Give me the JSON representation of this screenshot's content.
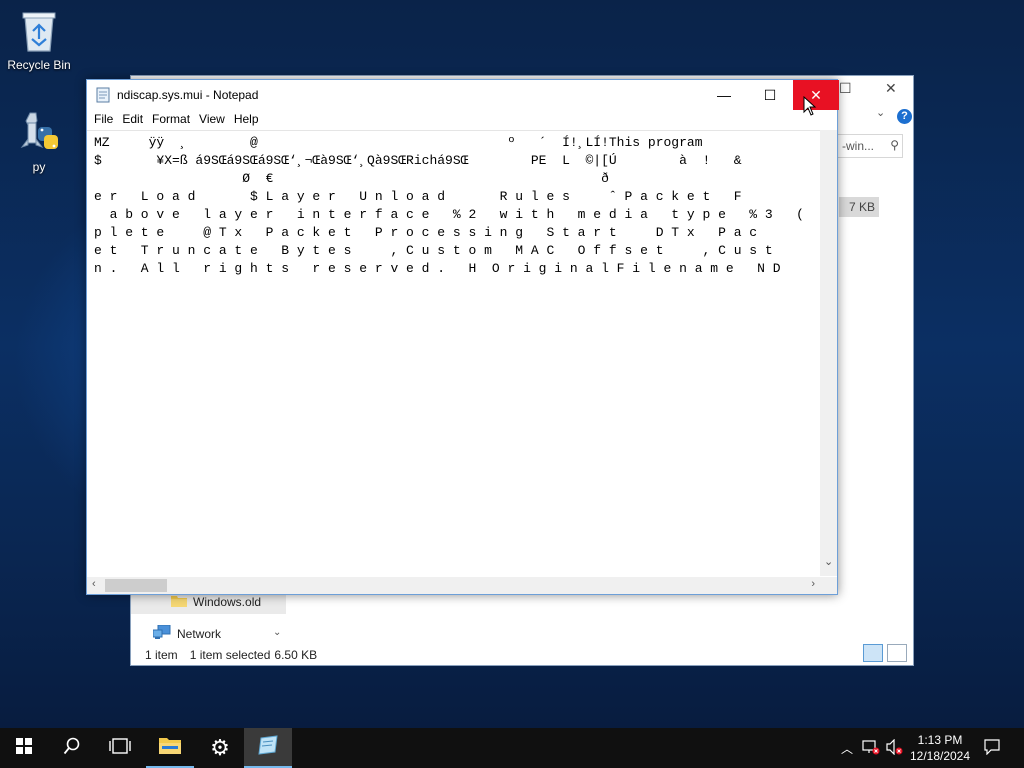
{
  "desktop": {
    "icons": [
      {
        "label": "Recycle Bin",
        "icon": "recycle-bin-icon"
      },
      {
        "label": "py",
        "icon": "python-icon"
      }
    ]
  },
  "explorer": {
    "search_placeholder": "-win...",
    "file_size": "7 KB",
    "nav_items": [
      {
        "label": "Windows.old",
        "icon": "folder-icon"
      },
      {
        "label": "Network",
        "icon": "network-icon"
      }
    ],
    "status": {
      "item_count": "1 item",
      "selected": "1 item selected",
      "size": "6.50 KB"
    }
  },
  "notepad": {
    "title": "ndiscap.sys.mui - Notepad",
    "menu": [
      "File",
      "Edit",
      "Format",
      "View",
      "Help"
    ],
    "lines": [
      "MZ     ÿÿ  ¸        @                                º   ´  Í!¸LÍ!This program",
      "$       ¥X=ß á9SŒá9SŒá9SŒ‘¸¬Œà9SŒ‘¸Qà9SŒRichá9SŒ        PE  L  ©|[Ú        à  !   &     ",
      "                   Ø  €                                          ð",
      "e r   L o a d       $ L a y e r   U n l o a d       R u l e s     ˆ P a c k e t   F",
      "  a b o v e   l a y e r   i n t e r f a c e   % 2   w i t h   m e d i a   t y p e   % 3   (",
      "p l e t e     @ T x   P a c k e t   P r o c e s s i n g   S t a r t     D T x   P a c",
      "e t   T r u n c a t e   B y t e s     , C u s t o m   M A C   O f f s e t     , C u s t",
      "n .   A l l   r i g h t s   r e s e r v e d .   H  O r i g i n a l F i l e n a m e   N D"
    ]
  },
  "taskbar": {
    "items": [
      "start-icon",
      "search-icon",
      "task-view-icon",
      "file-explorer-icon",
      "settings-icon",
      "notepad-icon"
    ],
    "clock": {
      "time": "1:13 PM",
      "date": "12/18/2024"
    }
  },
  "colors": {
    "close_hover": "#e81123",
    "taskbar": "#101010",
    "accent": "#76b9ed"
  }
}
